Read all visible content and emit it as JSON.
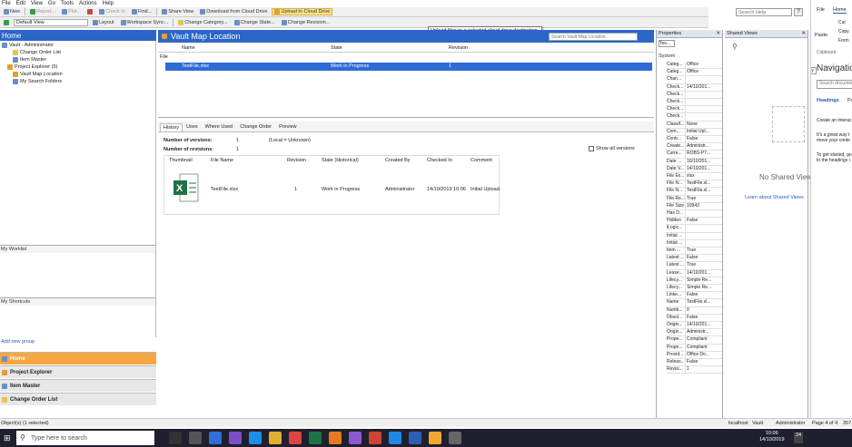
{
  "menu": [
    "File",
    "Edit",
    "View",
    "Go",
    "Tools",
    "Actions",
    "Help"
  ],
  "toolbar1": {
    "new": "New",
    "report": "Report...",
    "plot": "Plot...",
    "check_in": "Check In",
    "find": "Find...",
    "share_view": "Share View",
    "download": "Download from Cloud Drive",
    "upload": "Upload to Cloud Drive"
  },
  "toolbar2": {
    "view": "Default View",
    "layout": "Layout",
    "workspace": "Workspace Sync...",
    "change_category": "Change Category...",
    "change_state": "Change State...",
    "change_revision": "Change Revision..."
  },
  "tooltip": "Upload files to a selected cloud drive destination",
  "help_search": "Search Help",
  "left_nav": {
    "title": "Home",
    "tree": [
      "Vault - Administrator",
      "Change Order List",
      "Item Master",
      "Project Explorer (5)",
      "Vault Map Location",
      "My Search Folders"
    ],
    "worklist": "My Worklist",
    "shortcuts": "My Shortcuts",
    "add_group": "Add new group",
    "buttons": [
      "Home",
      "Project Explorer",
      "Item Master",
      "Change Order List"
    ]
  },
  "main": {
    "title": "Vault Map Location",
    "search_placeholder": "Search Vault Map Location",
    "columns": [
      "Name",
      "State",
      "Revision"
    ],
    "group": "File",
    "row": {
      "name": "TestFile.xlsx",
      "state": "Work in Progress",
      "revision": "1"
    }
  },
  "tabs": [
    "History",
    "Uses",
    "Where Used",
    "Change Order",
    "Preview"
  ],
  "history": {
    "versions_label": "Number of versions:",
    "versions": "1",
    "local": "(Local = Unknown)",
    "revisions_label": "Number of revisions:",
    "revisions": "1",
    "show_all": "Show all versions",
    "columns": [
      "Thumbnail",
      "File Name",
      "Revision",
      "State (Historical)",
      "Created By",
      "Checked In",
      "Comment"
    ],
    "row": {
      "file": "TestFile.xlsx",
      "revision": "1",
      "state": "Work in Progress",
      "created_by": "Administrator",
      "checked_in": "14/10/2019 10:06",
      "comment": "Initial Upload."
    }
  },
  "properties": {
    "title": "Properties",
    "selector": "Tes...",
    "group": "System",
    "rows": [
      [
        "Categ...",
        "Office"
      ],
      [
        "Categ...",
        "Office"
      ],
      [
        "Chan...",
        ""
      ],
      [
        "Check...",
        "14/10/201..."
      ],
      [
        "Check...",
        ""
      ],
      [
        "Check...",
        ""
      ],
      [
        "Check...",
        ""
      ],
      [
        "Check...",
        ""
      ],
      [
        "Classif...",
        "None"
      ],
      [
        "Com...",
        "Initial Upl..."
      ],
      [
        "Contr...",
        "False"
      ],
      [
        "Create...",
        "Administr..."
      ],
      [
        "Curre...",
        "ROBS-P7..."
      ],
      [
        "Date ...",
        "10/10/201..."
      ],
      [
        "Date V...",
        "14/10/201..."
      ],
      [
        "File Ex...",
        "xlsx"
      ],
      [
        "File N...",
        "TestFile.xl..."
      ],
      [
        "File N...",
        "TestFile.xl..."
      ],
      [
        "File Re...",
        "True"
      ],
      [
        "File Size",
        "10943"
      ],
      [
        "Has D...",
        ""
      ],
      [
        "Hidden",
        "False"
      ],
      [
        "iLogic...",
        ""
      ],
      [
        "Initial ...",
        ""
      ],
      [
        "Initial ...",
        ""
      ],
      [
        "Item ...",
        "True"
      ],
      [
        "Latest ...",
        "False"
      ],
      [
        "Latest ...",
        "True"
      ],
      [
        "Lease...",
        "14/10/201..."
      ],
      [
        "Lifecy...",
        "Simple Re..."
      ],
      [
        "Lifecy...",
        "Simple Re..."
      ],
      [
        "Linke...",
        "False"
      ],
      [
        "Name",
        "TestFile.xl..."
      ],
      [
        "Numb...",
        "0"
      ],
      [
        "Obsol...",
        "False"
      ],
      [
        "Origin...",
        "14/10/201..."
      ],
      [
        "Origin...",
        "Administr..."
      ],
      [
        "Prope...",
        "Compliant"
      ],
      [
        "Prope...",
        "Compliant"
      ],
      [
        "Provid...",
        "Office Do..."
      ],
      [
        "Releas...",
        "False"
      ],
      [
        "Revisi...",
        "1"
      ]
    ]
  },
  "shared_views": {
    "title": "Shared Views",
    "empty": "No Shared Views",
    "link": "Learn about Shared Views"
  },
  "word": {
    "tabs": [
      "File",
      "Home"
    ],
    "paste": "Paste",
    "cut": "Cut",
    "copy": "Copy",
    "format": "Form",
    "clipboard": "Clipboard",
    "nav_title": "Navigatio",
    "search": "Search documen",
    "headings": "Headings",
    "pages": "Pa",
    "para1": "Create an interac",
    "para2": "It's a great way t",
    "para3": "move your conte",
    "para4": "To get started, go",
    "para5": "to the headings i",
    "by": "By"
  },
  "status": {
    "left": "Object(s) (1 selected)",
    "server": "localhost",
    "vault": "Vault",
    "user": "Administrator",
    "page": "Page 4 of 4",
    "num": "357"
  },
  "taskbar": {
    "search": "Type here to search",
    "time": "10:06",
    "date": "14/10/2019",
    "badge": "24"
  }
}
